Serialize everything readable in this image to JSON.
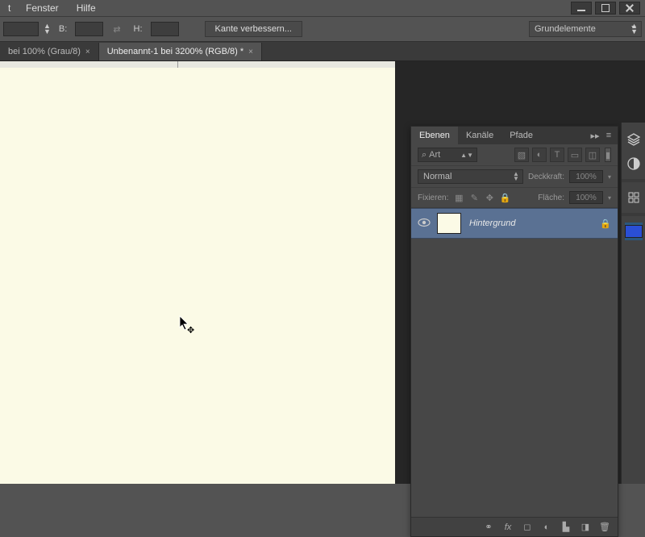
{
  "menubar": {
    "t": "t",
    "fenster": "Fenster",
    "hilfe": "Hilfe"
  },
  "options": {
    "b_label": "B:",
    "h_label": "H:",
    "refine_edge": "Kante verbessern...",
    "workspace": "Grundelemente"
  },
  "tabs": [
    {
      "label": "bei 100% (Grau/8)"
    },
    {
      "label": "Unbenannt-1 bei 3200% (RGB/8) *"
    }
  ],
  "panel": {
    "tab_ebenen": "Ebenen",
    "tab_kanale": "Kanäle",
    "tab_pfade": "Pfade",
    "search_label": "Art",
    "blend_mode": "Normal",
    "opacity_label": "Deckkraft:",
    "opacity_value": "100%",
    "fill_label": "Fläche:",
    "fill_value": "100%",
    "lock_label": "Fixieren:",
    "layer_name": "Hintergrund"
  }
}
